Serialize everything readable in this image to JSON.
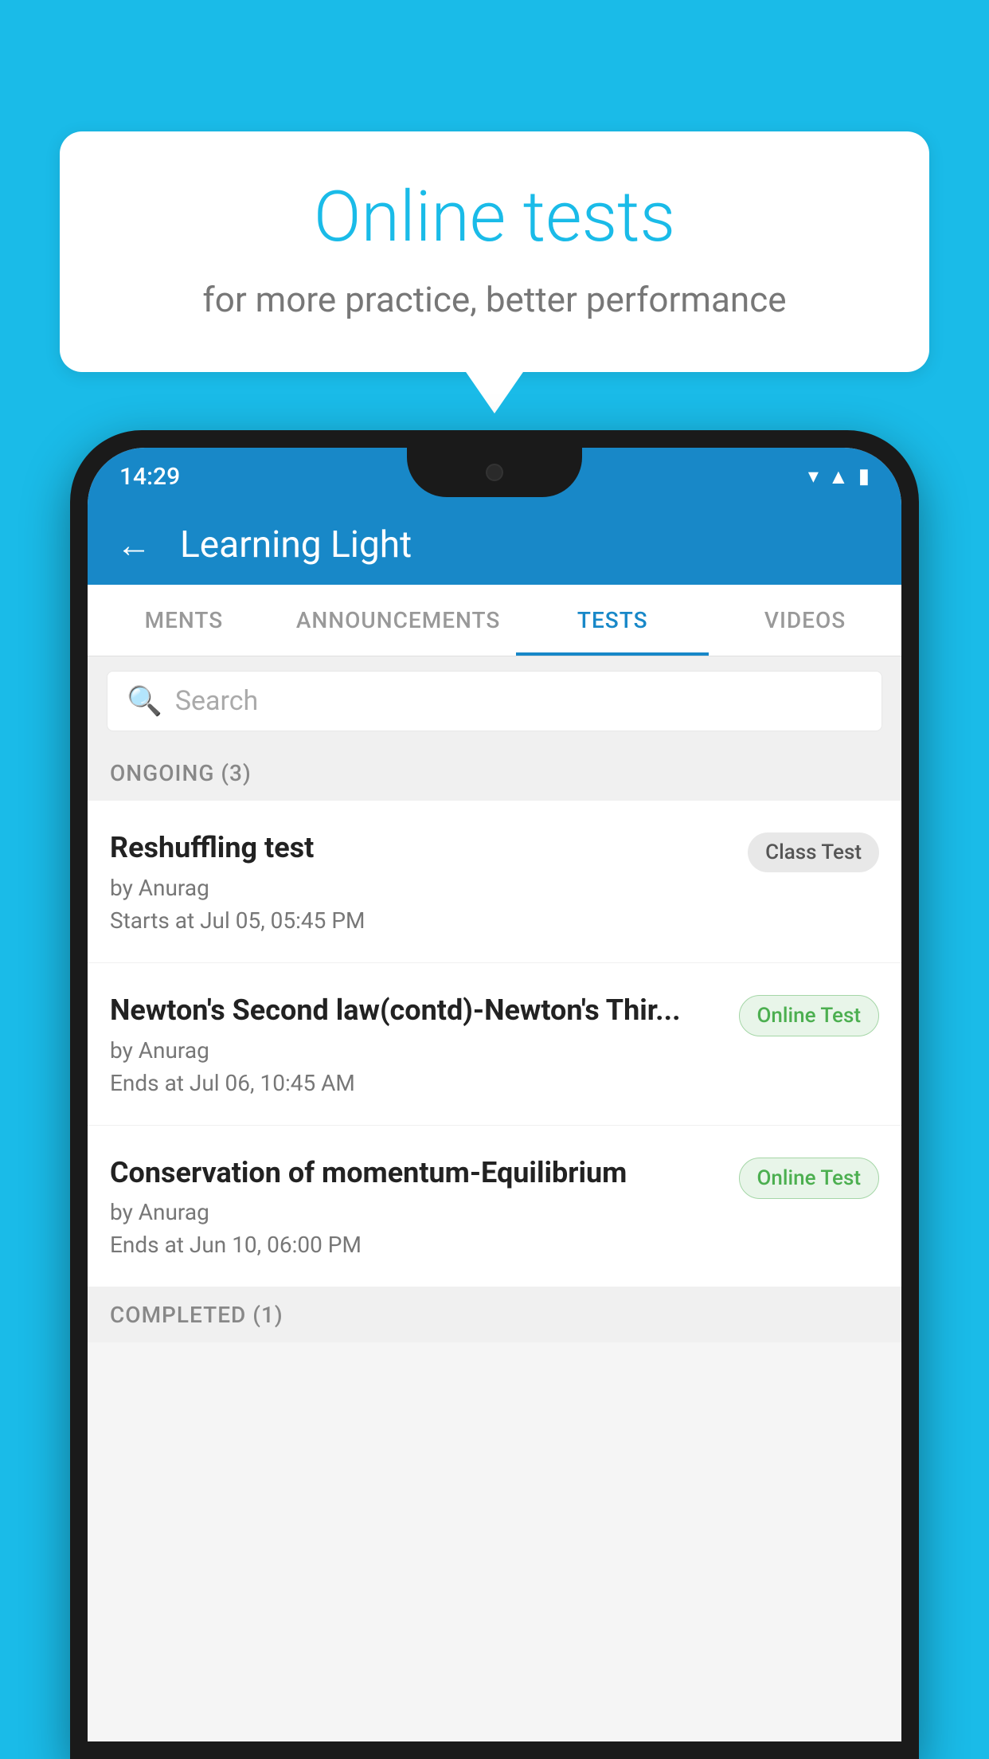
{
  "background_color": "#1ABBE8",
  "speech_bubble": {
    "title": "Online tests",
    "subtitle": "for more practice, better performance"
  },
  "status_bar": {
    "time": "14:29",
    "wifi_icon": "▾",
    "signal_icon": "▲",
    "battery_icon": "▮"
  },
  "app_header": {
    "back_label": "←",
    "title": "Learning Light"
  },
  "tabs": [
    {
      "label": "MENTS",
      "active": false
    },
    {
      "label": "ANNOUNCEMENTS",
      "active": false
    },
    {
      "label": "TESTS",
      "active": true
    },
    {
      "label": "VIDEOS",
      "active": false
    }
  ],
  "search": {
    "placeholder": "Search"
  },
  "ongoing_section": {
    "label": "ONGOING (3)"
  },
  "tests": [
    {
      "title": "Reshuffling test",
      "author": "by Anurag",
      "date": "Starts at  Jul 05, 05:45 PM",
      "badge": "Class Test",
      "badge_type": "class"
    },
    {
      "title": "Newton's Second law(contd)-Newton's Thir...",
      "author": "by Anurag",
      "date": "Ends at  Jul 06, 10:45 AM",
      "badge": "Online Test",
      "badge_type": "online"
    },
    {
      "title": "Conservation of momentum-Equilibrium",
      "author": "by Anurag",
      "date": "Ends at  Jun 10, 06:00 PM",
      "badge": "Online Test",
      "badge_type": "online"
    }
  ],
  "completed_section": {
    "label": "COMPLETED (1)"
  }
}
